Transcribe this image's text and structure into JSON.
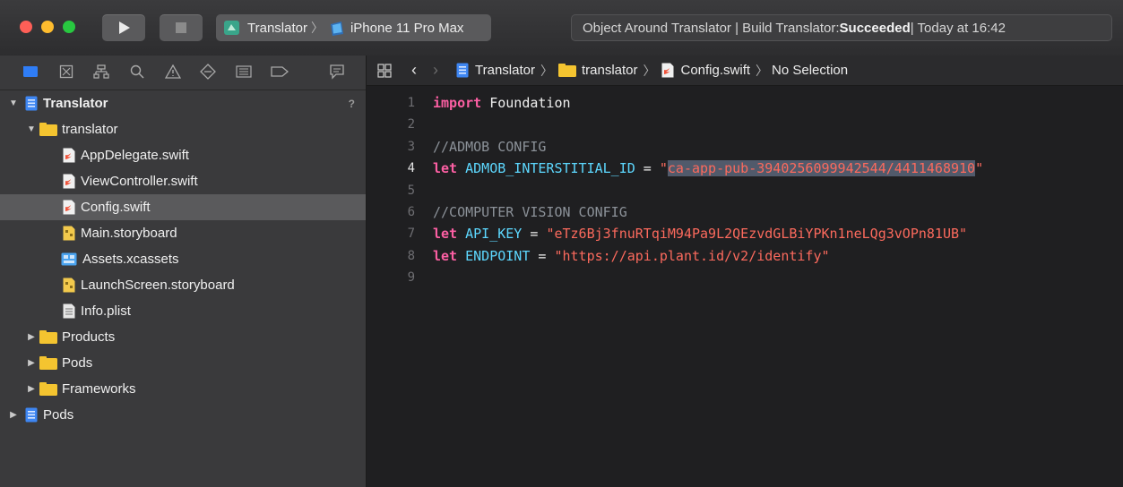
{
  "toolbar": {
    "scheme": {
      "target": "Translator",
      "device": "iPhone 11 Pro Max"
    },
    "status": {
      "prefix": "Object Around Translator | Build Translator: ",
      "result": "Succeeded",
      "suffix": " | Today at 16:42"
    },
    "colors": {
      "close": "#fe5f57",
      "minimize": "#febc2e",
      "zoom": "#28c840"
    }
  },
  "navigator": {
    "tabs": [
      "folder-icon",
      "source-control-icon",
      "hierarchy-icon",
      "find-icon",
      "warning-icon",
      "test-icon",
      "debug-icon",
      "breakpoint-icon",
      "report-icon"
    ],
    "items": [
      {
        "label": "Translator",
        "kind": "project",
        "badge": "?"
      },
      {
        "label": "translator",
        "kind": "folder"
      },
      {
        "label": "AppDelegate.swift",
        "kind": "swift"
      },
      {
        "label": "ViewController.swift",
        "kind": "swift"
      },
      {
        "label": "Config.swift",
        "kind": "swift",
        "selected": true
      },
      {
        "label": "Main.storyboard",
        "kind": "storyboard"
      },
      {
        "label": "Assets.xcassets",
        "kind": "assets"
      },
      {
        "label": "LaunchScreen.storyboard",
        "kind": "storyboard"
      },
      {
        "label": "Info.plist",
        "kind": "plist"
      },
      {
        "label": "Products",
        "kind": "folder"
      },
      {
        "label": "Pods",
        "kind": "folder"
      },
      {
        "label": "Frameworks",
        "kind": "folder"
      },
      {
        "label": "Pods",
        "kind": "project"
      }
    ]
  },
  "editor": {
    "jumpbar": {
      "project": "Translator",
      "folder": "translator",
      "file": "Config.swift",
      "selection": "No Selection"
    },
    "lines": [
      {
        "n": "1",
        "t": [
          [
            "kw",
            "import"
          ],
          [
            "plain",
            " Foundation"
          ]
        ]
      },
      {
        "n": "2",
        "t": []
      },
      {
        "n": "3",
        "t": [
          [
            "cmt",
            "//ADMOB CONFIG"
          ]
        ]
      },
      {
        "n": "4",
        "t": [
          [
            "kw",
            "let"
          ],
          [
            "plain",
            " "
          ],
          [
            "ident",
            "ADMOB_INTERSTITIAL_ID"
          ],
          [
            "plain",
            " = "
          ],
          [
            "str",
            "\""
          ],
          [
            "str hl",
            "ca-app-pub-3940256099942544/4411468910"
          ],
          [
            "str",
            "\""
          ]
        ],
        "current": true
      },
      {
        "n": "5",
        "t": []
      },
      {
        "n": "6",
        "t": [
          [
            "cmt",
            "//COMPUTER VISION CONFIG"
          ]
        ]
      },
      {
        "n": "7",
        "t": [
          [
            "kw",
            "let"
          ],
          [
            "plain",
            " "
          ],
          [
            "ident",
            "API_KEY"
          ],
          [
            "plain",
            " = "
          ],
          [
            "str",
            "\"eTz6Bj3fnuRTqiM94Pa9L2QEzvdGLBiYPKn1neLQg3vOPn81UB\""
          ]
        ]
      },
      {
        "n": "8",
        "t": [
          [
            "kw",
            "let"
          ],
          [
            "plain",
            " "
          ],
          [
            "ident",
            "ENDPOINT"
          ],
          [
            "plain",
            " = "
          ],
          [
            "str",
            "\"https://api.plant.id/v2/identify\""
          ]
        ]
      },
      {
        "n": "9",
        "t": []
      }
    ]
  }
}
